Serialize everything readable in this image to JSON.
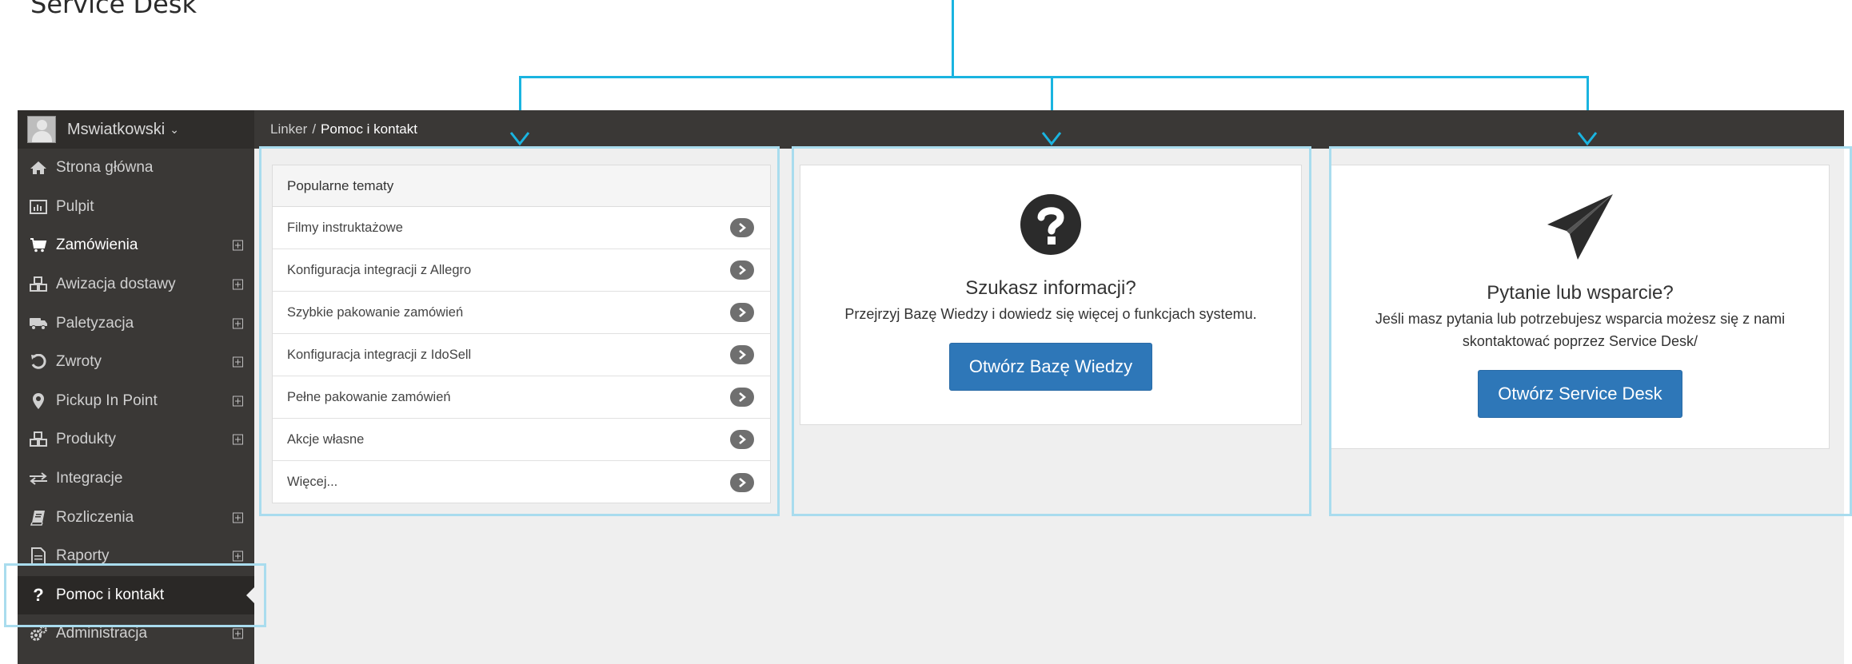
{
  "annotation": {
    "title": "Service Desk"
  },
  "sidebar": {
    "user_name": "Mswiatkowski",
    "items": [
      {
        "label": "Strona główna",
        "icon": "home-icon"
      },
      {
        "label": "Pulpit",
        "icon": "dashboard-icon"
      },
      {
        "label": "Zamówienia",
        "icon": "cart-icon"
      },
      {
        "label": "Awizacja dostawy",
        "icon": "cubes-icon"
      },
      {
        "label": "Paletyzacja",
        "icon": "truck-icon"
      },
      {
        "label": "Zwroty",
        "icon": "undo-icon"
      },
      {
        "label": "Pickup In Point",
        "icon": "map-marker-icon"
      },
      {
        "label": "Produkty",
        "icon": "cubes-icon"
      },
      {
        "label": "Integracje",
        "icon": "exchange-icon"
      },
      {
        "label": "Rozliczenia",
        "icon": "book-icon"
      },
      {
        "label": "Raporty",
        "icon": "file-text-icon"
      },
      {
        "label": "Pomoc i kontakt",
        "icon": "question-icon"
      },
      {
        "label": "Administracja",
        "icon": "cogs-icon"
      }
    ]
  },
  "breadcrumb": {
    "parent": "Linker",
    "separator": "/",
    "current": "Pomoc i kontakt"
  },
  "topics": {
    "header": "Popularne tematy",
    "items": [
      "Filmy instruktażowe",
      "Konfiguracja integracji z Allegro",
      "Szybkie pakowanie zamówień",
      "Konfiguracja integracji z IdoSell",
      "Pełne pakowanie zamówień",
      "Akcje własne",
      "Więcej..."
    ]
  },
  "knowledge_base": {
    "title": "Szukasz informacji?",
    "description": "Przejrzyj Bazę Wiedzy i dowiedz się więcej o funkcjach systemu.",
    "button": "Otwórz Bazę Wiedzy"
  },
  "service_desk": {
    "title": "Pytanie lub wsparcie?",
    "description": "Jeśli masz pytania lub potrzebujesz wsparcia możesz się z nami skontaktować poprzez Service Desk/",
    "button": "Otwórz Service Desk"
  },
  "colors": {
    "annotation": "#1ab4e0",
    "highlight": "#a9dcee",
    "sidebar": "#3a3836",
    "primary_button": "#2e77b8"
  }
}
